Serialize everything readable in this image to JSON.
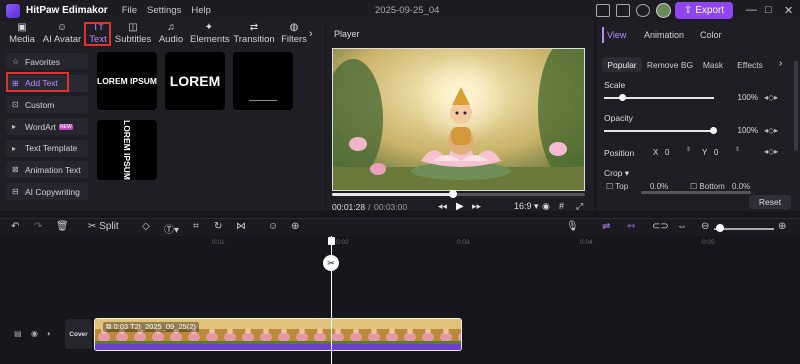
{
  "app": {
    "title": "HitPaw Edimakor",
    "menus": [
      "File",
      "Settings",
      "Help"
    ],
    "doc_title": "2025-09-25_04",
    "export_label": "Export"
  },
  "media_tabs": [
    {
      "label": "Media",
      "icon": "media-icon"
    },
    {
      "label": "AI Avatar",
      "icon": "ai-avatar-icon"
    },
    {
      "label": "Text",
      "icon": "text-icon",
      "selected": true
    },
    {
      "label": "Subtitles",
      "icon": "subtitles-icon"
    },
    {
      "label": "Audio",
      "icon": "audio-icon"
    },
    {
      "label": "Elements",
      "icon": "elements-icon"
    },
    {
      "label": "Transition",
      "icon": "transition-icon"
    },
    {
      "label": "Filters",
      "icon": "filters-icon"
    }
  ],
  "text_sidebar": [
    {
      "label": "Favorites",
      "icon": "star-icon"
    },
    {
      "label": "Add Text",
      "icon": "add-text-icon",
      "active": true
    },
    {
      "label": "Custom",
      "icon": "custom-icon"
    },
    {
      "label": "WordArt",
      "icon": "chevron-right-icon",
      "badge": "NEW"
    },
    {
      "label": "Text Template",
      "icon": "chevron-right-icon"
    },
    {
      "label": "Animation Text",
      "icon": "animation-text-icon"
    },
    {
      "label": "AI Copywriting",
      "icon": "ai-copywriting-icon"
    }
  ],
  "text_presets": [
    "LOREM IPSUM",
    "LOREM",
    "",
    "LOREM IPSUM"
  ],
  "player": {
    "label": "Player",
    "current_time": "00:01:28",
    "total_time": "00:03:00",
    "progress": 0.48,
    "aspect": "16:9"
  },
  "properties": {
    "tabs": [
      "View",
      "Animation",
      "Color"
    ],
    "subtabs": [
      "Popular",
      "Remove BG",
      "Mask",
      "Effects"
    ],
    "scale_label": "Scale",
    "scale_value": "100%",
    "scale_level": 0.0,
    "opacity_label": "Opacity",
    "opacity_value": "100%",
    "opacity_level": 1.0,
    "position_label": "Position",
    "pos_x_label": "X",
    "pos_x": "0",
    "pos_y_label": "Y",
    "pos_y": "0",
    "crop_label": "Crop",
    "crop_top_label": "Top",
    "crop_top": "0.0%",
    "crop_bottom_label": "Bottom",
    "crop_bottom": "0.0%",
    "reset_label": "Reset"
  },
  "toolbar": {
    "split_label": "Split"
  },
  "ruler": [
    "0:01",
    "0:02",
    "0:03",
    "0:04",
    "0:05"
  ],
  "timeline": {
    "cover_label": "Cover",
    "clip_label": "0:03  T2I_2025_09_25(2)"
  }
}
